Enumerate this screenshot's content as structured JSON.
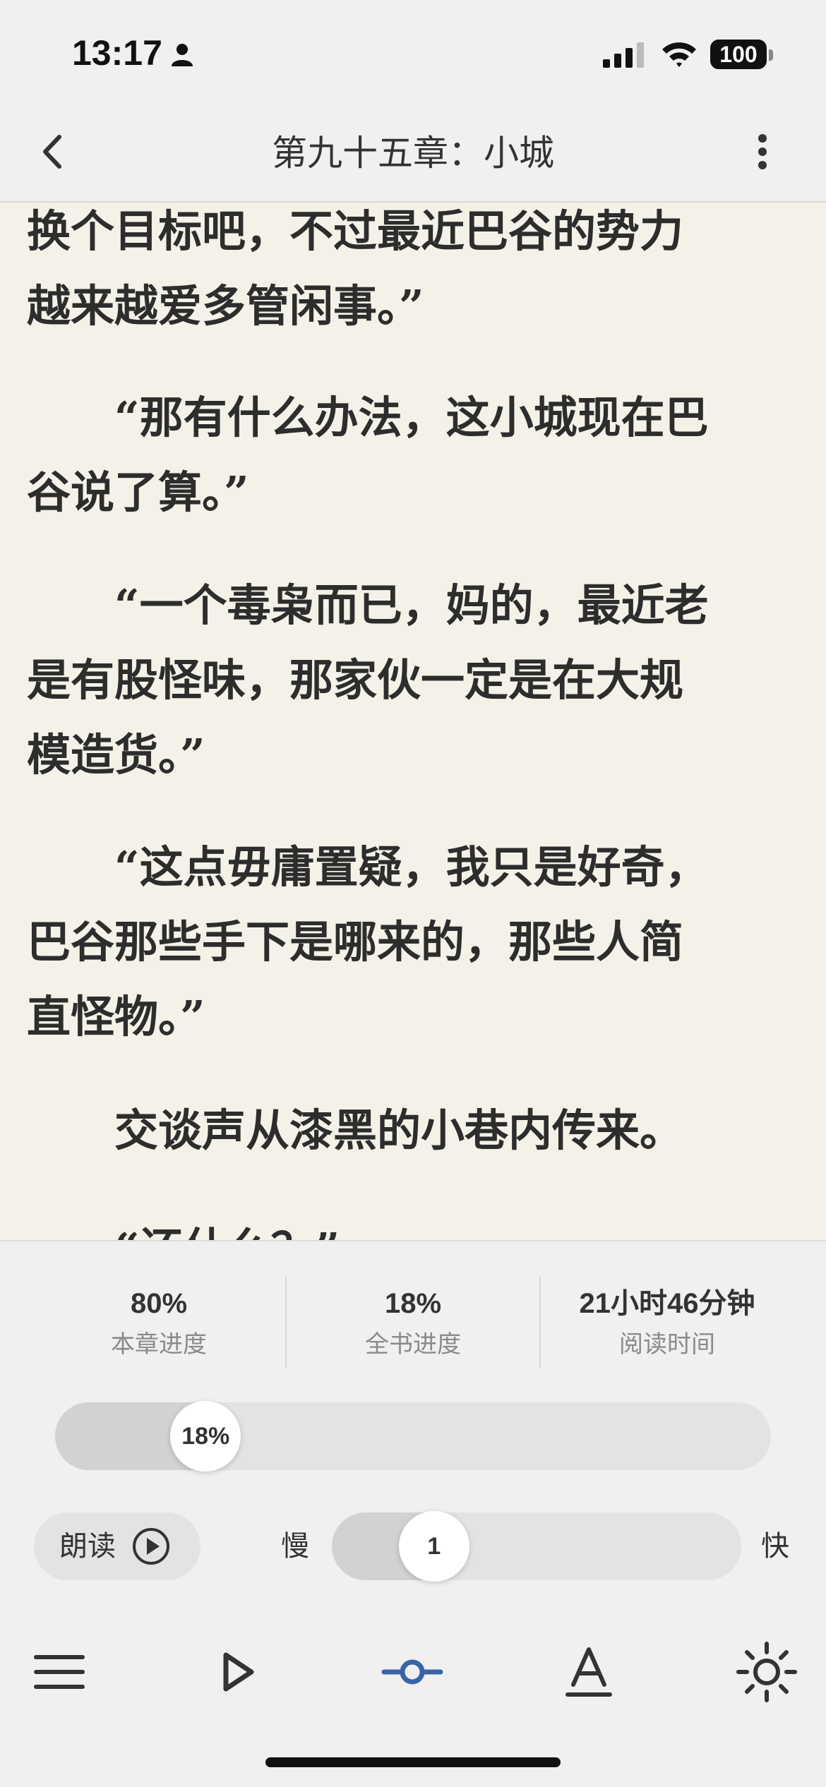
{
  "status_bar": {
    "time": "13:17",
    "battery": "100",
    "icons": [
      "person-icon",
      "cellular-signal-icon",
      "wifi-icon",
      "battery-icon"
    ]
  },
  "nav": {
    "title": "第九十五章：小城",
    "back_icon": "chevron-left-icon",
    "more_icon": "more-vertical-icon"
  },
  "content": {
    "paragraphs": [
      "换个目标吧，不过最近巴谷的势力\n越来越爱多管闲事。”",
      "　　“那有什么办法，这小城现在巴\n谷说了算。”",
      "　　“一个毒枭而已，妈的，最近老\n是有股怪味，那家伙一定是在大规\n模造货。”",
      "　　“这点毋庸置疑，我只是好奇，\n巴谷那些手下是哪来的，那些人简\n直怪物。”",
      "　　交谈声从漆黑的小巷内传来。",
      "　　“还什么？”"
    ]
  },
  "stats": {
    "chapter_progress": {
      "value": "80%",
      "label": "本章进度"
    },
    "book_progress": {
      "value": "18%",
      "label": "全书进度"
    },
    "reading_time": {
      "value": "21小时46分钟",
      "label": "阅读时间"
    }
  },
  "progress_slider": {
    "value_label": "18%",
    "fraction": 0.18
  },
  "tts": {
    "read_aloud_label": "朗读",
    "slow_label": "慢",
    "fast_label": "快",
    "speed_value": "1",
    "speed_fraction": 0.2
  },
  "toolbar": {
    "items": [
      "menu-icon",
      "play-icon",
      "progress-icon",
      "font-icon",
      "brightness-icon"
    ],
    "active_color": "#3a64a8",
    "inactive_color": "#333333"
  },
  "colors": {
    "page_background": "#f4f2e8",
    "panel_background": "#f0f0f0"
  }
}
